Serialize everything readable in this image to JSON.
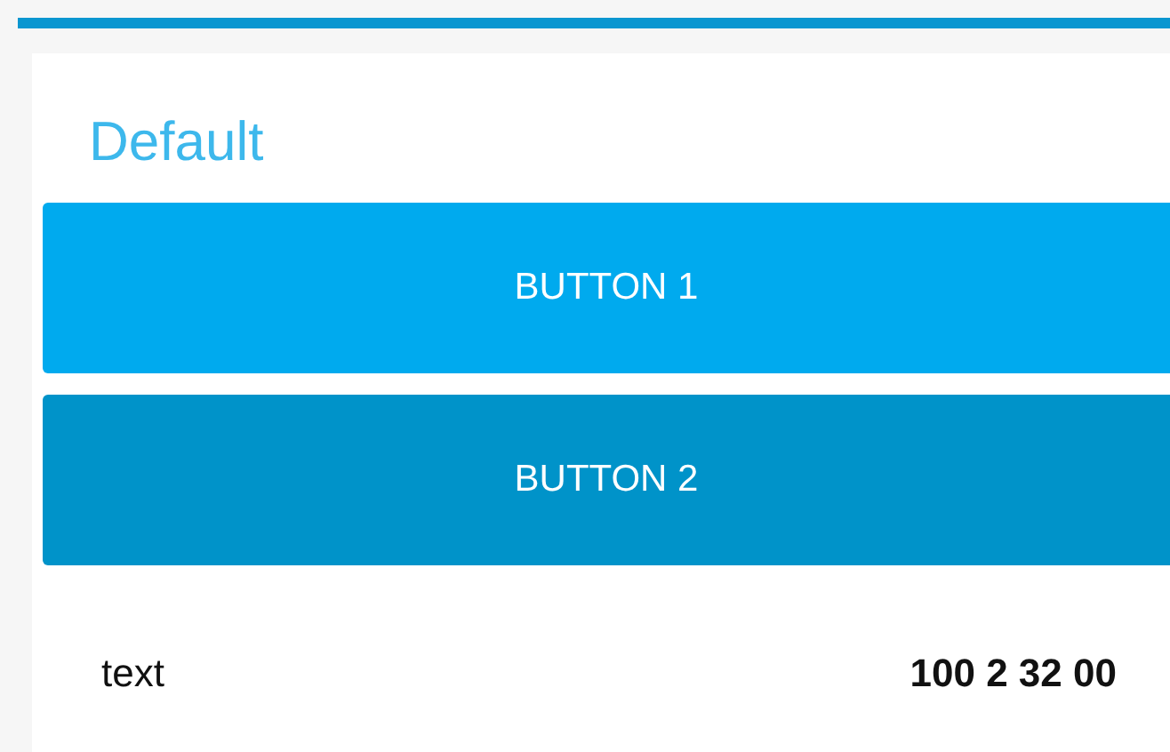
{
  "title": "Default",
  "buttons": [
    {
      "label": "BUTTON 1",
      "kind": "primary"
    },
    {
      "label": "BUTTON 2",
      "kind": "secondary"
    }
  ],
  "row": {
    "label": "text",
    "value": "100 2 32 00"
  }
}
